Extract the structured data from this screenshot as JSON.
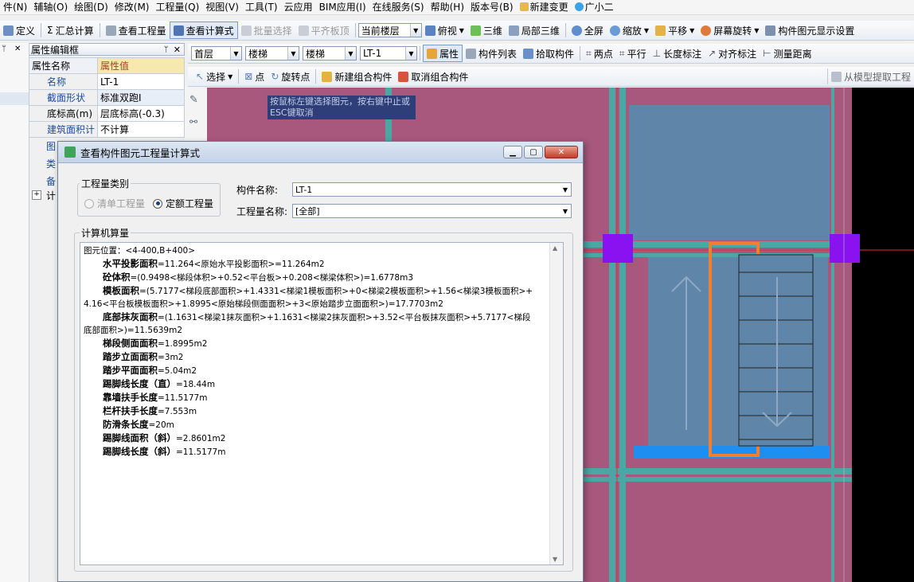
{
  "menu": [
    "件(N)",
    "辅轴(O)",
    "绘图(D)",
    "修改(M)",
    "工程量(Q)",
    "视图(V)",
    "工具(T)",
    "云应用",
    "BIM应用(I)",
    "在线服务(S)",
    "帮助(H)",
    "版本号(B)",
    "新建变更",
    "广小二"
  ],
  "toolbar1": {
    "define": "定义",
    "sum": "汇总计算",
    "view_qty": "查看工程量",
    "view_formula": "查看计算式",
    "batch_select": "批量选择",
    "align_slab": "平齐板顶",
    "current_floor": "当前楼层",
    "top_view": "俯视",
    "three_d": "三维",
    "local_3d": "局部三维",
    "fullscreen": "全屏",
    "zoom": "缩放",
    "pan": "平移",
    "rotate": "屏幕旋转",
    "display_settings": "构件图元显示设置"
  },
  "toolbar2": {
    "floor": "首层",
    "category": "楼梯",
    "type": "楼梯",
    "member": "LT-1",
    "properties": "属性",
    "member_list": "构件列表",
    "pick": "拾取构件",
    "two_points": "两点",
    "parallel": "平行",
    "length_dim": "长度标注",
    "align_dim": "对齐标注",
    "measure": "测量距离"
  },
  "toolbar3": {
    "select": "选择",
    "point": "点",
    "rotate_point": "旋转点",
    "new_group": "新建组合构件",
    "cancel_group": "取消组合构件",
    "extract": "从模型提取工程"
  },
  "prop_panel": {
    "title": "属性编辑框",
    "col_name": "属性名称",
    "col_value": "属性值",
    "rows": [
      {
        "name": "名称",
        "value": "LT-1"
      },
      {
        "name": "截面形状",
        "value": "标准双跑I"
      },
      {
        "name": "底标高(m)",
        "value": "层底标高(-0.3)"
      },
      {
        "name": "建筑面积计",
        "value": "不计算"
      }
    ],
    "partial": [
      "图",
      "类",
      "备",
      "计"
    ]
  },
  "tooltip": "按鼠标左键选择图元，按右键中止或ESC键取消",
  "dialog": {
    "title": "查看构件图元工程量计算式",
    "qty_type_label": "工程量类别",
    "radio_bill": "清单工程量",
    "radio_quota": "定额工程量",
    "member_name_label": "构件名称:",
    "member_name_value": "LT-1",
    "qty_name_label": "工程量名称:",
    "qty_name_value": "[全部]",
    "computed_label": "计算机算量",
    "lines": [
      {
        "bold": "",
        "text": "图元位置：<4-400,B+400>"
      },
      {
        "bold": "水平投影面积",
        "text": "=11.264<原始水平投影面积>=11.264m2"
      },
      {
        "bold": "砼体积",
        "text": "=(0.9498<梯段体积>+0.52<平台板>+0.208<梯梁体积>)=1.6778m3"
      },
      {
        "bold": "模板面积",
        "text": "=(5.7177<梯段底部面积>+1.4331<梯梁1模板面积>+0<梯梁2模板面积>+1.56<梯梁3模板面积>+"
      },
      {
        "bold": "",
        "text": "4.16<平台板模板面积>+1.8995<原始梯段侧面面积>+3<原始踏步立面面积>)=17.7703m2"
      },
      {
        "bold": "底部抹灰面积",
        "text": "=(1.1631<梯梁1抹灰面积>+1.1631<梯梁2抹灰面积>+3.52<平台板抹灰面积>+5.7177<梯段"
      },
      {
        "bold": "",
        "text": "底部面积>)=11.5639m2"
      },
      {
        "bold": "梯段侧面面积",
        "text": "=1.8995m2"
      },
      {
        "bold": "踏步立面面积",
        "text": "=3m2"
      },
      {
        "bold": "踏步平面面积",
        "text": "=5.04m2"
      },
      {
        "bold": "踢脚线长度（直）",
        "text": "=18.44m"
      },
      {
        "bold": "靠墙扶手长度",
        "text": "=11.5177m"
      },
      {
        "bold": "栏杆扶手长度",
        "text": "=7.553m"
      },
      {
        "bold": "防滑条长度",
        "text": "=20m"
      },
      {
        "bold": "踢脚线面积（斜）",
        "text": "=2.8601m2"
      },
      {
        "bold": "踢脚线长度（斜）",
        "text": "=11.5177m"
      }
    ]
  },
  "colors": {
    "canvas_magenta": "#a8587c",
    "slab_blue": "#5f86a8",
    "beam_teal": "#4aa7a3",
    "column_purple": "#8a12f0",
    "bar_blue": "#1e8ff0",
    "orange": "#f08030"
  }
}
